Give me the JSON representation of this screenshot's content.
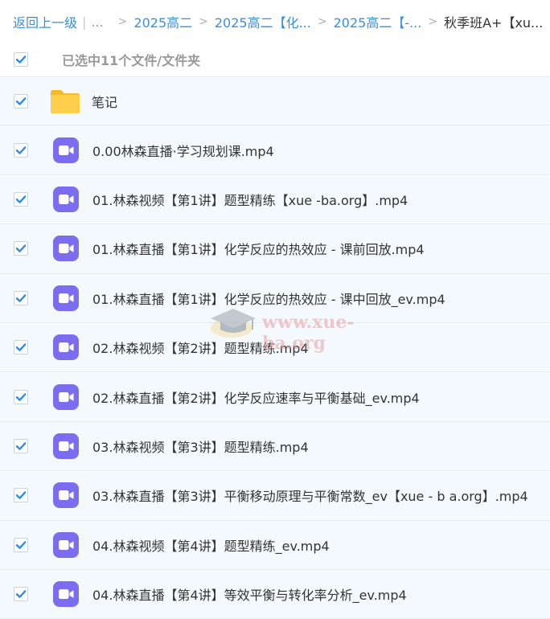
{
  "breadcrumb": {
    "back_label": "返回上一级",
    "ellipsis": "...",
    "items": [
      "2025高二",
      "2025高二【化...",
      "2025高二【-..."
    ],
    "current": "秋季班A+【xu..."
  },
  "selection": {
    "status": "已选中11个文件/文件夹"
  },
  "files": [
    {
      "name": "笔记",
      "type": "folder"
    },
    {
      "name": "0.00林森直播·学习规划课.mp4",
      "type": "video"
    },
    {
      "name": "01.林森视频【第1讲】题型精练【xue -ba.org】.mp4",
      "type": "video"
    },
    {
      "name": "01.林森直播【第1讲】化学反应的热效应 - 课前回放.mp4",
      "type": "video"
    },
    {
      "name": "01.林森直播【第1讲】化学反应的热效应 - 课中回放_ev.mp4",
      "type": "video"
    },
    {
      "name": "02.林森视频【第2讲】题型精练.mp4",
      "type": "video"
    },
    {
      "name": "02.林森直播【第2讲】化学反应速率与平衡基础_ev.mp4",
      "type": "video"
    },
    {
      "name": "03.林森视频【第3讲】题型精练.mp4",
      "type": "video"
    },
    {
      "name": "03.林森直播【第3讲】平衡移动原理与平衡常数_ev【xue - b a.org】.mp4",
      "type": "video"
    },
    {
      "name": "04.林森视频【第4讲】题型精练_ev.mp4",
      "type": "video"
    },
    {
      "name": "04.林森直播【第4讲】等效平衡与转化率分析_ev.mp4",
      "type": "video"
    }
  ],
  "watermark": {
    "text": "www.xue-ba.org"
  },
  "colors": {
    "link": "#3b8fd9",
    "checkbox": "#2e8be6",
    "video_icon": "#7b6cf0",
    "folder": "#ffcf4b",
    "row_bg": "#f4f9fd"
  }
}
